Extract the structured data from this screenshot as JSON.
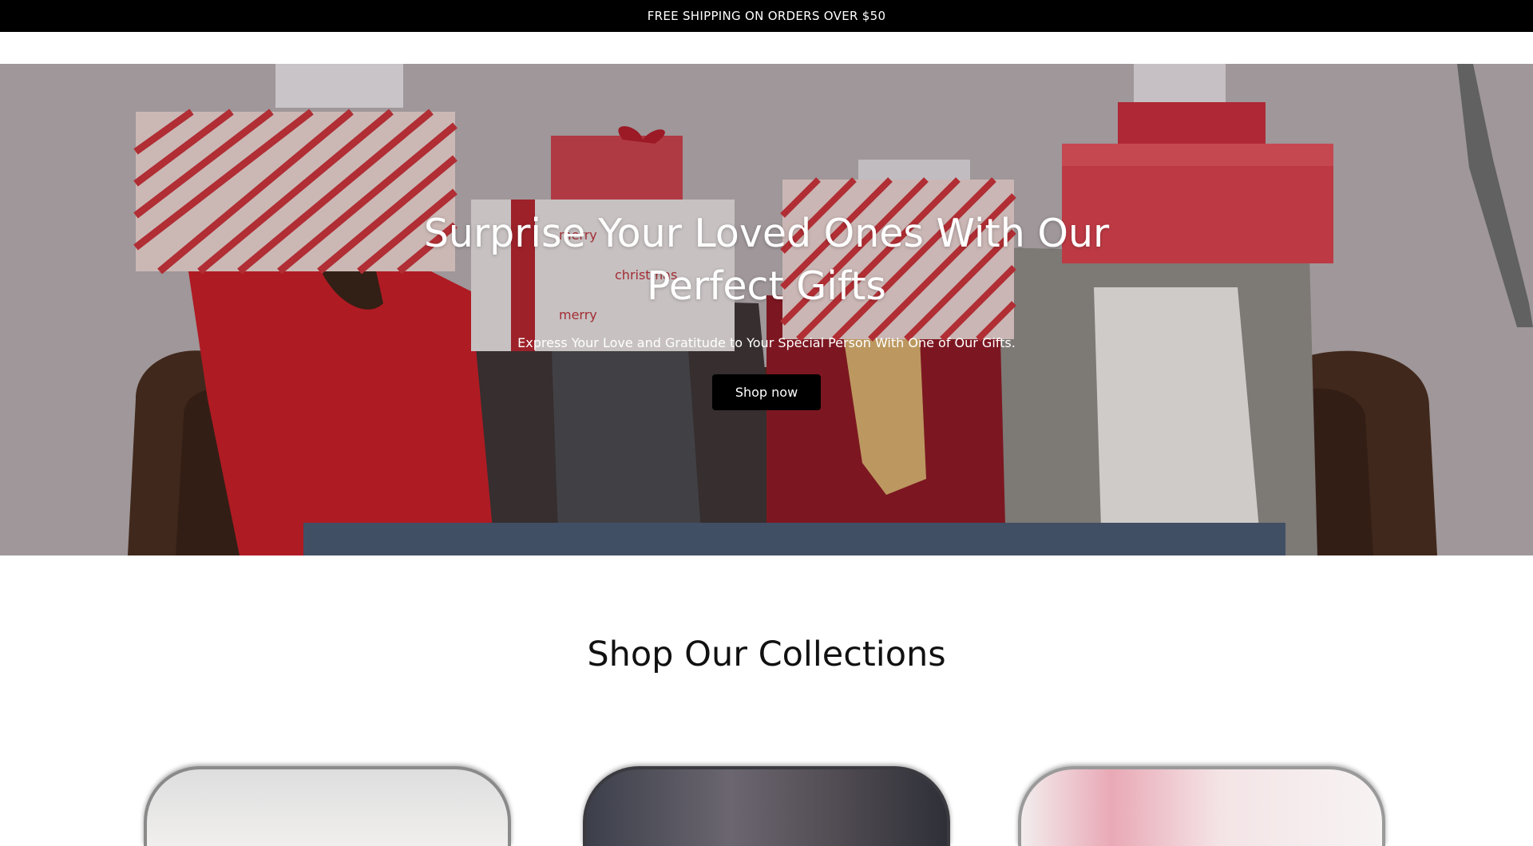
{
  "announcement": {
    "text": "FREE SHIPPING ON ORDERS OVER $50"
  },
  "hero": {
    "title": "Surprise Your Loved Ones With Our Perfect Gifts",
    "subtitle": "Express Your Love and Gratitude to Your Special Person With One of Our Gifts.",
    "button_label": "Shop now",
    "image": "people-holding-gift-boxes-on-sofa"
  },
  "collections": {
    "heading": "Shop Our Collections"
  },
  "colors": {
    "announcement_bg": "#000000",
    "button_bg": "#000000",
    "text_on_dark": "#ffffff"
  }
}
